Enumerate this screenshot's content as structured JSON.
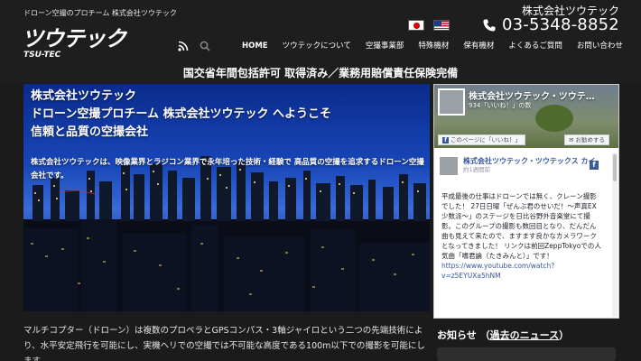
{
  "header": {
    "tagline": "ドローン空撮のプロチーム 株式会社ツウテック",
    "logo_main": "ツウテック",
    "logo_sub": "TSU-TEC",
    "company_name": "株式会社ツウテック",
    "phone": "03-5348-8852",
    "flags": [
      "jp-flag",
      "us-flag"
    ],
    "nav_icons": [
      "rss-icon",
      "search-icon"
    ],
    "nav": [
      "HOME",
      "ツウテックについて",
      "空撮事業部",
      "特殊機材",
      "保有機材",
      "よくあるご質問",
      "お問い合わせ"
    ]
  },
  "banner": "国交省年間包括許可 取得済み／業務用賠償責任保険完備",
  "hero": {
    "title_lines": [
      "株式会社ツウテック",
      "ドローン空撮プロチーム 株式会社ツウテック へようこそ",
      "信頼と品質の空撮会社"
    ],
    "description": "株式会社ツウテックは、映像業界とラジコン業界で永年培った技術・経験で 高品質の空撮を追求するドローン空撮会社です。"
  },
  "intro": "マルチコプター（ドローン）は複数のプロペラとGPSコンパス・3軸ジャイロという二つの先端技術により、水平安定飛行を可能にし、実機ヘリでの空撮では不可能な高度である100m以下での撮影を可能にします。",
  "facebook": {
    "page_name": "株式会社ツウテック・ツウテ…",
    "likes": "934「いいね！」の数",
    "like_button": "このページに「いいね！」",
    "share_button": "お勧めする",
    "post_author": "株式会社ツウテック・ツウテックス カイ",
    "post_time": "約1週間前",
    "post_text": "平成最後の仕事はドローンでは無く、クレーン撮影でした！ 27日日曜「ぜんぶ君のせいだ！〜声真EX少数派〜」のステージを日比谷野外音楽堂にて撮影。このグループの撮影も数回目となり、だんだん曲も見えて来たので、ますます良かなカメラワークとなってきました！ リンクは前回ZeppTokyoでの人気曲「嗜君論（たきみんと）」です！",
    "post_link": "https://www.youtube.com/watch?v=z5EYUXa5hNM"
  },
  "news": {
    "label": "お知らせ",
    "link": "過去のニュース"
  }
}
